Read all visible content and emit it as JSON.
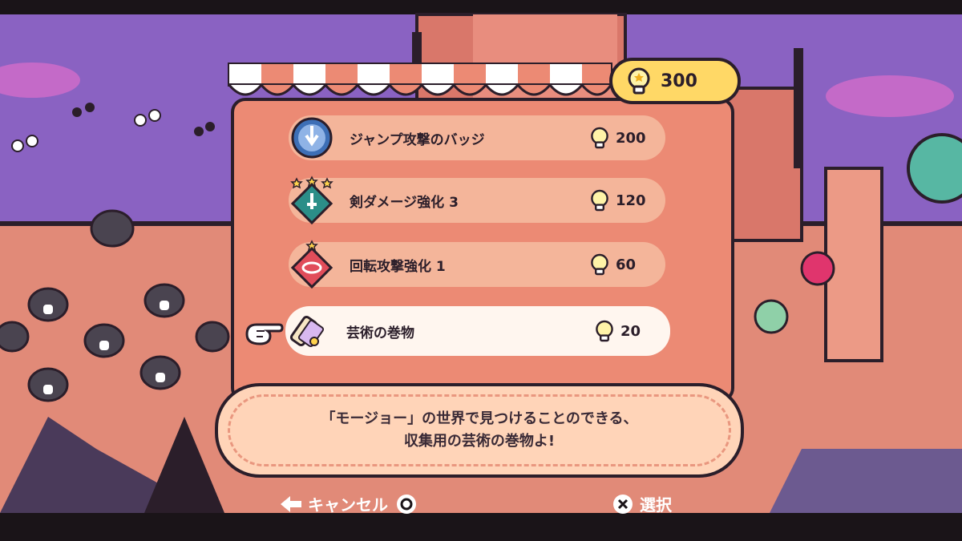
{
  "currency": {
    "amount": "300",
    "icon": "lightbulb-coin-icon"
  },
  "shop": {
    "items": [
      {
        "name": "ジャンプ攻撃のバッジ",
        "price": "200",
        "icon": "jump-badge-icon",
        "stars": 0,
        "badge_color": "#3d6fb6",
        "selected": false
      },
      {
        "name": "剣ダメージ強化 3",
        "price": "120",
        "icon": "sword-upgrade-icon",
        "stars": 3,
        "badge_color": "#2b8e88",
        "selected": false
      },
      {
        "name": "回転攻撃強化 1",
        "price": "60",
        "icon": "spin-upgrade-icon",
        "stars": 1,
        "badge_color": "#e14d5a",
        "selected": false
      },
      {
        "name": "芸術の巻物",
        "price": "20",
        "icon": "art-scroll-icon",
        "stars": 0,
        "badge_color": "#f2d9a6",
        "selected": true
      }
    ]
  },
  "description": {
    "line1": "「モージョー」の世界で見つけることのできる、",
    "line2": "収集用の芸術の巻物よ!"
  },
  "controls": {
    "cancel_label": "キャンセル",
    "select_label": "選択"
  },
  "colors": {
    "panel": "#ec8a74",
    "item": "#f4b59a",
    "item_selected": "#fff6ef",
    "currency_bg": "#ffd866",
    "outline": "#2b1e2a"
  }
}
